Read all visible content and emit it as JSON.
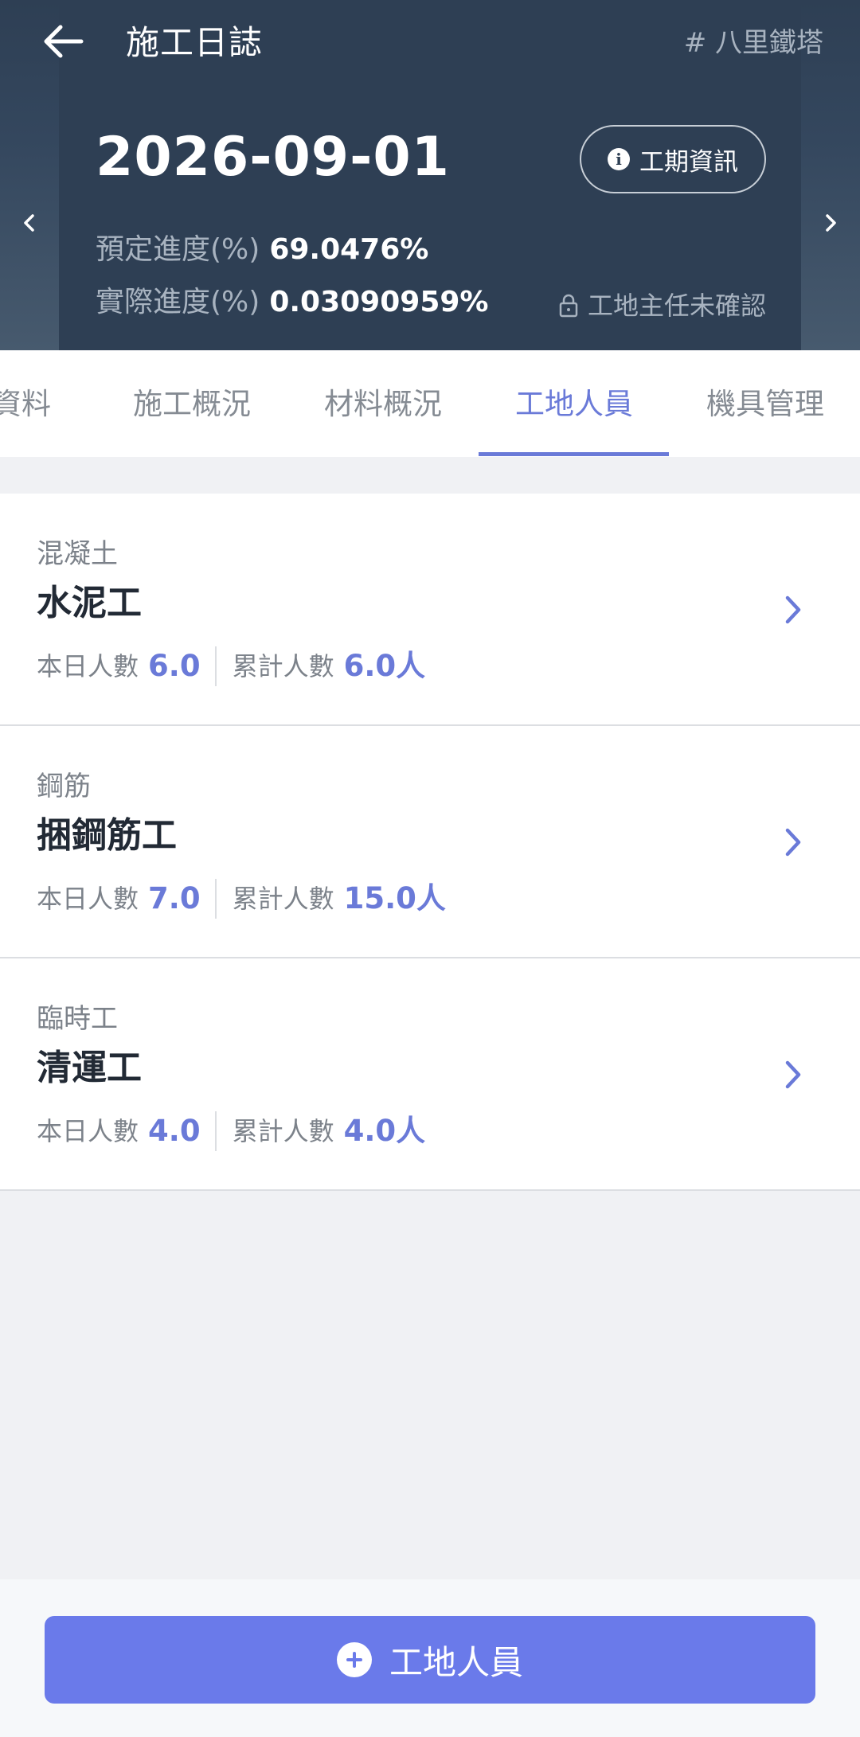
{
  "header": {
    "title": "施工日誌",
    "project_tag": "# 八里鐵塔",
    "date": "2026-09-01",
    "info_button_label": "工期資訊",
    "planned_progress_label": "預定進度(%)",
    "planned_progress_value": "69.0476%",
    "actual_progress_label": "實際進度(%)",
    "actual_progress_value": "0.03090959%",
    "confirm_status": "工地主任未確認"
  },
  "tabs": [
    {
      "label": "資料"
    },
    {
      "label": "施工概況"
    },
    {
      "label": "材料概況"
    },
    {
      "label": "工地人員",
      "active": true
    },
    {
      "label": "機具管理"
    }
  ],
  "workers": [
    {
      "category": "混凝土",
      "name": "水泥工",
      "today_label": "本日人數",
      "today_value": "6.0",
      "total_label": "累計人數",
      "total_value": "6.0人"
    },
    {
      "category": "鋼筋",
      "name": "捆鋼筋工",
      "today_label": "本日人數",
      "today_value": "7.0",
      "total_label": "累計人數",
      "total_value": "15.0人"
    },
    {
      "category": "臨時工",
      "name": "清運工",
      "today_label": "本日人數",
      "today_value": "4.0",
      "total_label": "累計人數",
      "total_value": "4.0人"
    }
  ],
  "footer": {
    "add_button_label": "工地人員"
  },
  "colors": {
    "header_bg": "#2e3f54",
    "accent": "#6a7ad8",
    "button": "#6a7aea"
  }
}
